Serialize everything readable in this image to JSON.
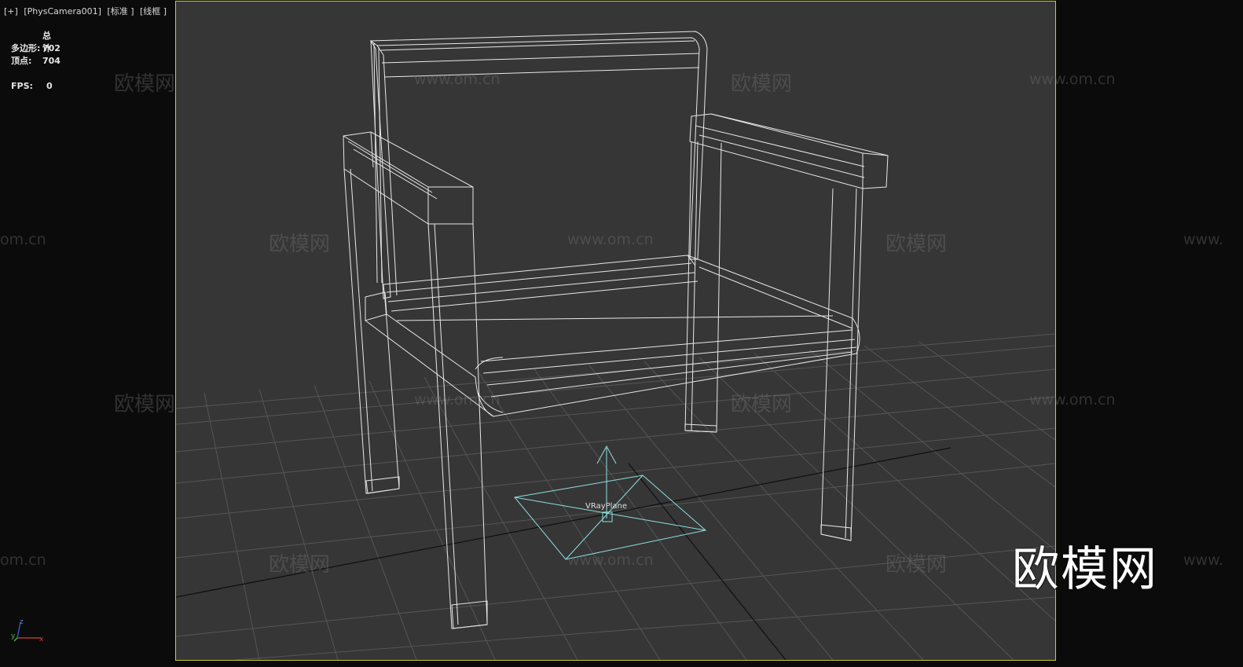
{
  "viewport": {
    "labels": [
      "[+]",
      "[PhysCamera001]",
      "[标准 ]",
      "[线框 ]"
    ]
  },
  "stats": {
    "header": "总计",
    "polygons_label": "多边形:",
    "polygons_value": "702",
    "vertices_label": "顶点:",
    "vertices_value": "704",
    "fps_label": "FPS:",
    "fps_value": "0"
  },
  "scene": {
    "helper_label": "VRayPlane",
    "wireframe_color": "#e8e8e8",
    "helper_color": "#8fe0e0",
    "grid_color": "#555555",
    "frame_color": "#c8c83a"
  },
  "watermarks": {
    "cn": "欧模网",
    "url": "www.om.cn",
    "url_partial_left": "om.cn",
    "url_partial_right": "www."
  },
  "brand": {
    "logo_text": "欧模网"
  },
  "axis": {
    "x": "x",
    "y": "y",
    "z": "z"
  }
}
